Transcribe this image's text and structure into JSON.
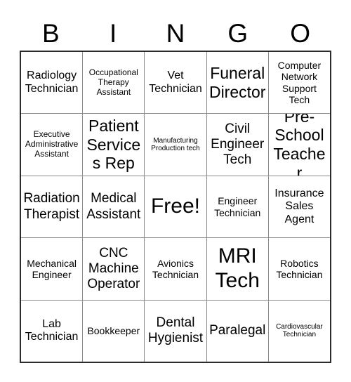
{
  "card": {
    "title": "BINGO",
    "header_letters": [
      "B",
      "I",
      "N",
      "G",
      "O"
    ],
    "free_space_label": "Free!",
    "rows": 5,
    "columns": 5,
    "colors": {
      "background": "#ffffff",
      "text": "#000000",
      "outer_border": "#2b2b2b",
      "inner_grid_line": "#8a8a8a"
    },
    "grid": [
      [
        {
          "label": "Radiology Technician",
          "size": "lg"
        },
        {
          "label": "Occupational Therapy Assistant",
          "size": "sm"
        },
        {
          "label": "Vet Technician",
          "size": "lg"
        },
        {
          "label": "Funeral Director",
          "size": "xxl"
        },
        {
          "label": "Computer Network Support Tech",
          "size": "md"
        }
      ],
      [
        {
          "label": "Executive Administrative Assistant",
          "size": "sm"
        },
        {
          "label": "Patient Services Rep",
          "size": "xxl"
        },
        {
          "label": "Manufacturing Production tech",
          "size": "xs"
        },
        {
          "label": "Civil Engineer Tech",
          "size": "xl"
        },
        {
          "label": "Pre-School Teacher",
          "size": "xxl"
        }
      ],
      [
        {
          "label": "Radiation Therapist",
          "size": "xl"
        },
        {
          "label": "Medical Assistant",
          "size": "xl"
        },
        {
          "label": "Free!",
          "size": "huge",
          "free": true
        },
        {
          "label": "Engineer Technician",
          "size": "md"
        },
        {
          "label": "Insurance Sales Agent",
          "size": "lg"
        }
      ],
      [
        {
          "label": "Mechanical Engineer",
          "size": "md"
        },
        {
          "label": "CNC Machine Operator",
          "size": "xl"
        },
        {
          "label": "Avionics Technician",
          "size": "md"
        },
        {
          "label": "MRI Tech",
          "size": "huge"
        },
        {
          "label": "Robotics Technician",
          "size": "md"
        }
      ],
      [
        {
          "label": "Lab Technician",
          "size": "lg"
        },
        {
          "label": "Bookkeeper",
          "size": "md"
        },
        {
          "label": "Dental Hygienist",
          "size": "xl"
        },
        {
          "label": "Paralegal",
          "size": "xl"
        },
        {
          "label": "Cardiovascular Technician",
          "size": "xs"
        }
      ]
    ]
  }
}
